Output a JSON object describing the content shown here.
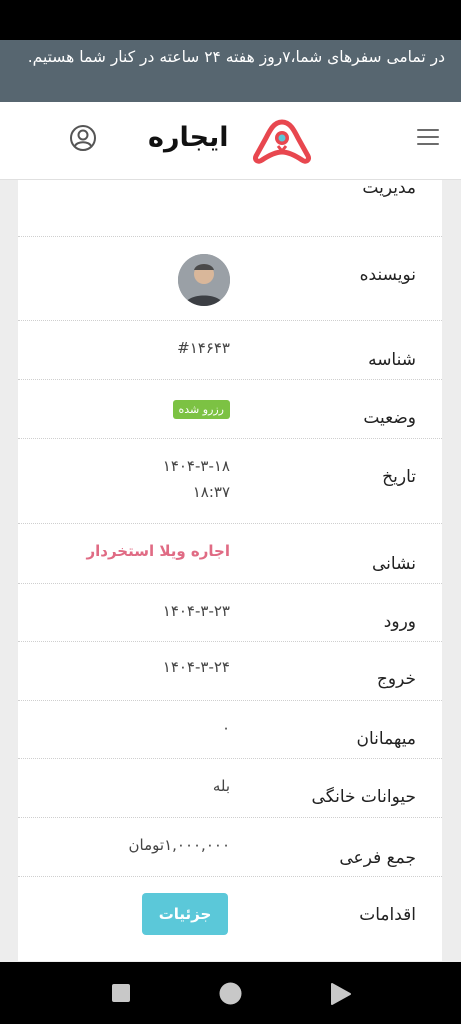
{
  "announcement": "در تمامی سفرهای شما،۷روز هفته ۲۴ ساعته در کنار شما هستیم.",
  "header": {
    "logo_text": "ایجاره"
  },
  "rows": {
    "management": {
      "label": "مدیریت"
    },
    "author": {
      "label": "نویسنده"
    },
    "id": {
      "label": "شناسه",
      "value": "#۱۴۶۴۳"
    },
    "status": {
      "label": "وضعیت",
      "value": "رزرو شده"
    },
    "date": {
      "label": "تاریخ",
      "value_line1": "۱۴۰۴-۳-۱۸",
      "value_line2": "۱۸:۳۷"
    },
    "address": {
      "label": "نشانی",
      "value": "اجاره ویلا استخردار"
    },
    "checkin": {
      "label": "ورود",
      "value": "۱۴۰۴-۳-۲۳"
    },
    "checkout": {
      "label": "خروج",
      "value": "۱۴۰۴-۳-۲۴"
    },
    "guests": {
      "label": "میهمانان",
      "value": "۰"
    },
    "pets": {
      "label": "حیوانات خانگی",
      "value": "بله"
    },
    "subtotal": {
      "label": "جمع فرعی",
      "value": "۱,۰۰۰,۰۰۰تومان"
    },
    "actions": {
      "label": "اقدامات",
      "button": "جزئیات"
    }
  },
  "colors": {
    "announcement_bg": "#576670",
    "badge_green": "#7cc243",
    "link_pink": "#e06b84",
    "button_cyan": "#5bc8d9",
    "logo_red": "#e8474f"
  },
  "icons": [
    "hamburger-menu-icon",
    "user-account-icon",
    "square-recents-icon",
    "circle-home-icon",
    "triangle-back-icon"
  ]
}
